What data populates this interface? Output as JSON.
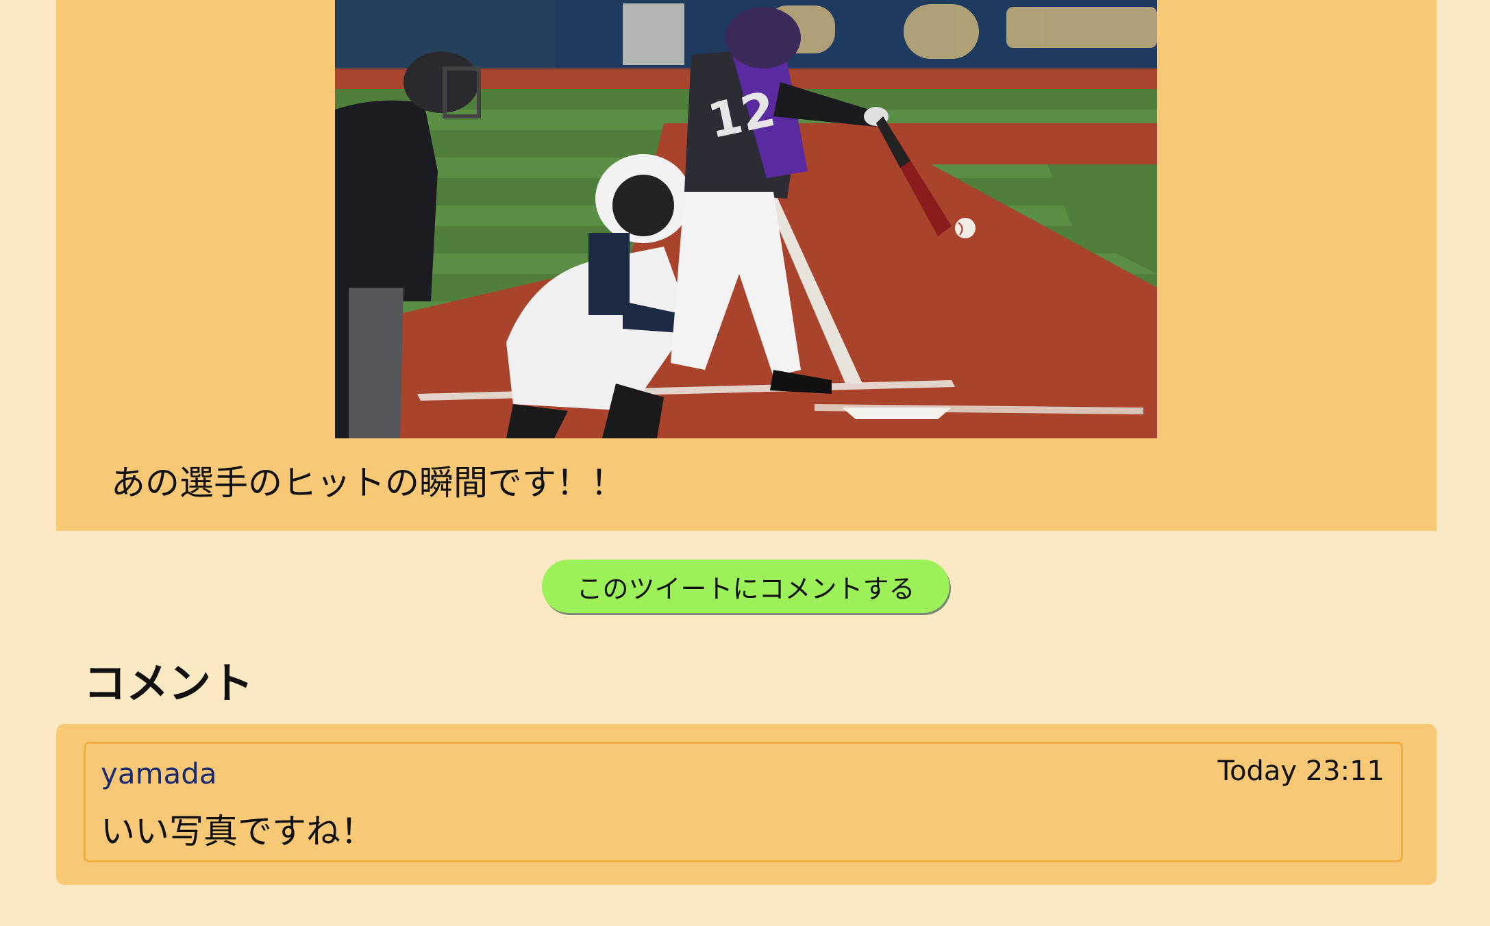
{
  "tweet": {
    "text": "あの選手のヒットの瞬間です！！",
    "photo_subject": "baseball-batter-hit-photo"
  },
  "actions": {
    "comment_button_label": "このツイートにコメントする"
  },
  "comments_section": {
    "heading": "コメント",
    "comments": [
      {
        "user": "yamada",
        "time": "Today 23:11",
        "body": "いい写真ですね！"
      }
    ]
  },
  "colors": {
    "page_background": "#fbe9c3",
    "card_background": "#f7c976",
    "button_background": "#9cf158",
    "comment_border": "#f0ad40"
  }
}
